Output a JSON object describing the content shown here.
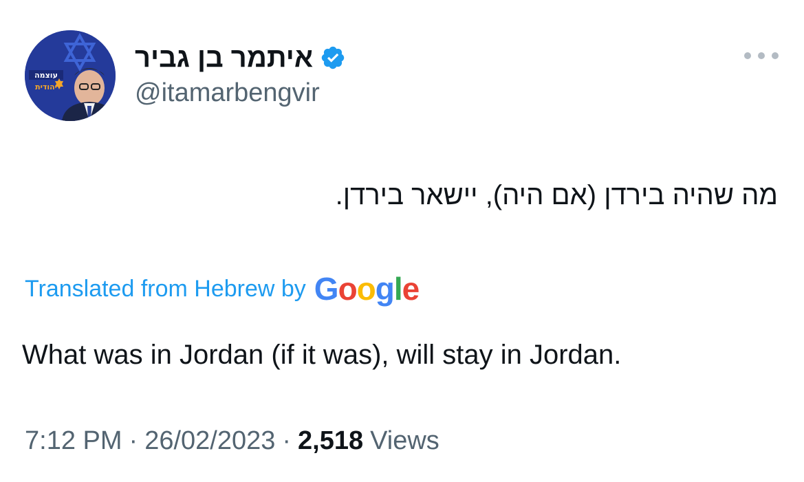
{
  "author": {
    "display_name": "איתמר בן גביר",
    "handle": "@itamarbengvir",
    "verified": true,
    "avatar_icon": "profile-photo",
    "avatar_logo_lines": [
      "עוצמה",
      "יהודית"
    ]
  },
  "tweet": {
    "text": "מה שהיה בירדן (אם היה), יישאר בירדן.",
    "translation_label": "Translated from Hebrew by",
    "translation_provider": {
      "letters": [
        "G",
        "o",
        "o",
        "g",
        "l",
        "e"
      ],
      "colors": [
        "#4285f4",
        "#ea4335",
        "#fbbc05",
        "#4285f4",
        "#34a853",
        "#ea4335"
      ]
    },
    "translated_text": "What was in Jordan (if it was), will stay in Jordan.",
    "time": "7:12 PM",
    "separator": "·",
    "date": "26/02/2023",
    "views_count": "2,518",
    "views_label": "Views"
  },
  "icons": {
    "verified": "verified-badge-icon",
    "more": "more-options-icon"
  },
  "colors": {
    "link": "#1d9bf0",
    "secondary_text": "#536471",
    "primary_text": "#0f1419"
  }
}
